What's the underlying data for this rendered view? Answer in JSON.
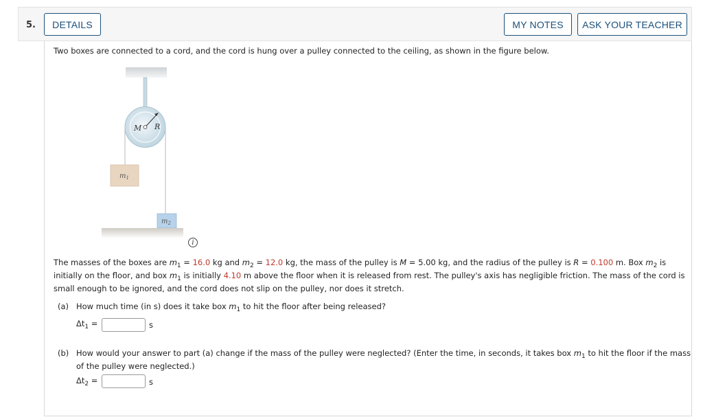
{
  "question": {
    "number": "5.",
    "details_label": "DETAILS",
    "my_notes_label": "MY NOTES",
    "ask_teacher_label": "ASK YOUR TEACHER"
  },
  "intro": "Two boxes are connected to a cord, and the cord is hung over a pulley connected to the ceiling, as shown in the figure below.",
  "figure": {
    "pulley_mass_label": "M",
    "pulley_radius_label": "R",
    "box1_label": "m",
    "box1_sub": "1",
    "box2_label": "m",
    "box2_sub": "2",
    "info_icon": "i"
  },
  "problem": {
    "l1_a": "The masses of the boxes are ",
    "m1_sym": "m",
    "sub1": "1",
    "eq": " = ",
    "m1_val": "16.0",
    "l1_b": " kg and ",
    "m2_sym": "m",
    "sub2": "2",
    "m2_val": "12.0",
    "l1_c": " kg, the mass of the pulley is ",
    "M_sym": "M",
    "l1_d": " = 5.00 kg, and the radius of the pulley is ",
    "R_sym": "R",
    "R_val": "0.100",
    "l1_e": " m. Box ",
    "l1_f": " is",
    "l2_a": "initially on the floor, and box ",
    "l2_b": " is initially ",
    "h_val": "4.10",
    "l2_c": " m above the floor when it is released from rest. The pulley's axis has negligible friction. The mass of the cord is",
    "l3": "small enough to be ignored, and the cord does not slip on the pulley, nor does it stretch."
  },
  "part_a": {
    "label": "(a)",
    "q1": "How much time (in s) does it take box ",
    "q2": " to hit the floor after being released?",
    "answer_label": "Δt",
    "answer_sub": "1",
    "equals": "=",
    "answer_value": "",
    "unit": "s"
  },
  "part_b": {
    "label": "(b)",
    "q1": "How would your answer to part (a) change if the mass of the pulley were neglected? (Enter the time, in seconds, it takes box ",
    "q2": " to hit the floor if the mass",
    "q3": "of the pulley were neglected.)",
    "answer_label": "Δt",
    "answer_sub": "2",
    "equals": "=",
    "answer_value": "",
    "unit": "s"
  }
}
